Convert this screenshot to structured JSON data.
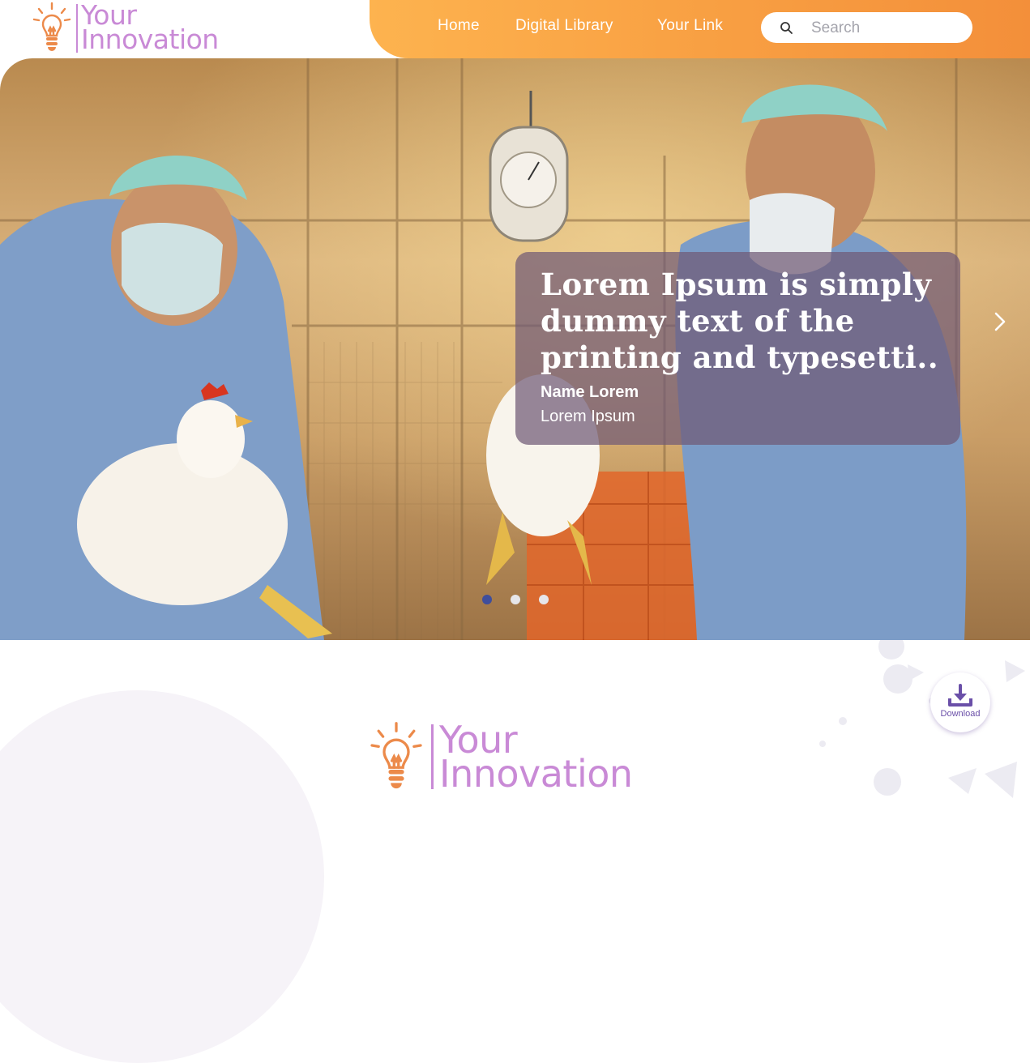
{
  "brand": {
    "line1": "Your",
    "line2": "Innovation"
  },
  "nav": {
    "items": [
      {
        "label": "Home"
      },
      {
        "label": "Digital Library"
      },
      {
        "label": "Your Link"
      }
    ]
  },
  "search": {
    "placeholder": "Search"
  },
  "hero": {
    "title": "Lorem Ipsum is simply dummy text of the printing and typesetti..",
    "name": "Name Lorem",
    "subtitle": "Lorem Ipsum",
    "slides_total": 3,
    "active_slide": 1
  },
  "download": {
    "label": "Download"
  },
  "colors": {
    "accent_orange": "#f7a044",
    "brand_purple": "#c98ad6",
    "active_dot": "#3f4e9c",
    "inactive_dot": "#e6e6ea"
  },
  "icons": {
    "logo": "lightbulb-icon",
    "search": "search-icon",
    "next": "chevron-right-icon",
    "download": "download-icon"
  }
}
